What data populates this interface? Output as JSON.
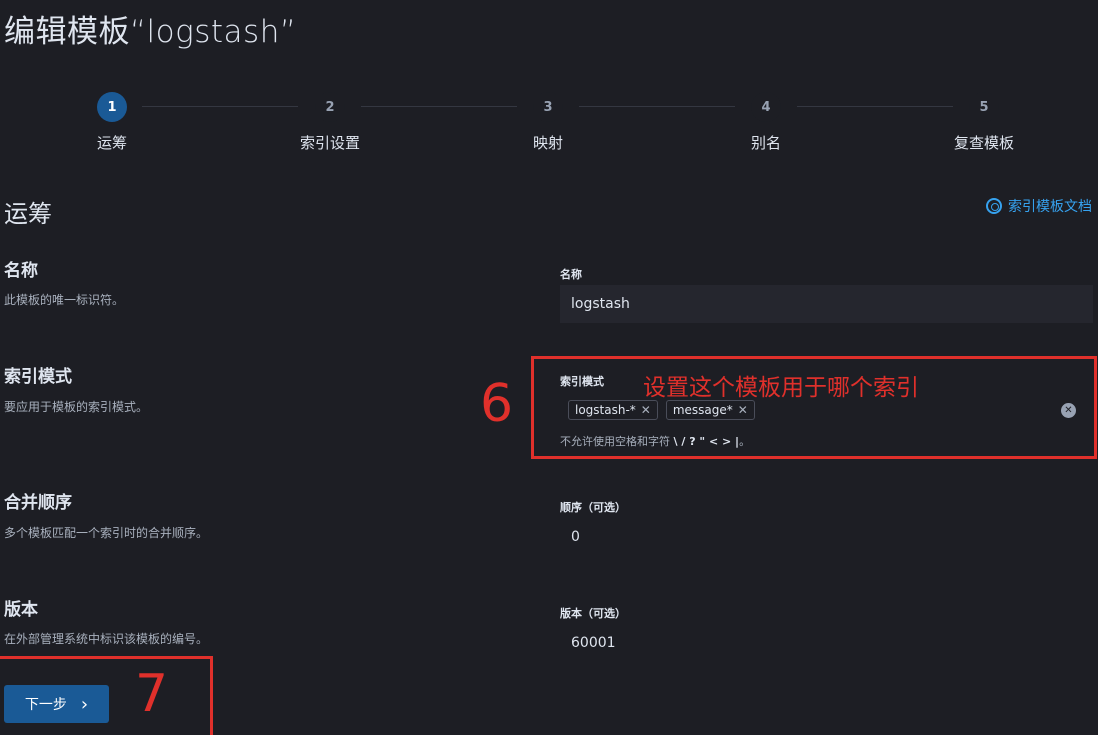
{
  "header": {
    "title": "编辑模板“logstash”"
  },
  "steps": [
    {
      "number": "1",
      "label": "运筹",
      "active": true
    },
    {
      "number": "2",
      "label": "索引设置",
      "active": false
    },
    {
      "number": "3",
      "label": "映射",
      "active": false
    },
    {
      "number": "4",
      "label": "别名",
      "active": false
    },
    {
      "number": "5",
      "label": "复查模板",
      "active": false
    }
  ],
  "section": {
    "title": "运筹",
    "docs_link": "索引模板文档"
  },
  "rows": {
    "name": {
      "title": "名称",
      "desc": "此模板的唯一标识符。",
      "field_label": "名称",
      "value": "logstash"
    },
    "index_pattern": {
      "title": "索引模式",
      "desc": "要应用于模板的索引模式。",
      "field_label": "索引模式",
      "chips": [
        "logstash-*",
        "message*"
      ],
      "help_prefix": "不允许使用空格和字符",
      "help_chars": "\\ / ? \" < > |",
      "help_suffix": "。"
    },
    "order": {
      "title": "合并顺序",
      "desc": "多个模板匹配一个索引时的合并顺序。",
      "field_label": "顺序（可选）",
      "value": "0"
    },
    "version": {
      "title": "版本",
      "desc": "在外部管理系统中标识该模板的编号。",
      "field_label": "版本（可选）",
      "value": "60001"
    }
  },
  "next_button": {
    "label": "下一步",
    "chevron": "›"
  },
  "annotations": {
    "six": "6",
    "six_text": "设置这个模板用于哪个索引",
    "seven": "7",
    "color": "#e0302b"
  },
  "colors": {
    "background": "#1d1e24",
    "accent": "#1a5a96",
    "link": "#36a2ef"
  }
}
